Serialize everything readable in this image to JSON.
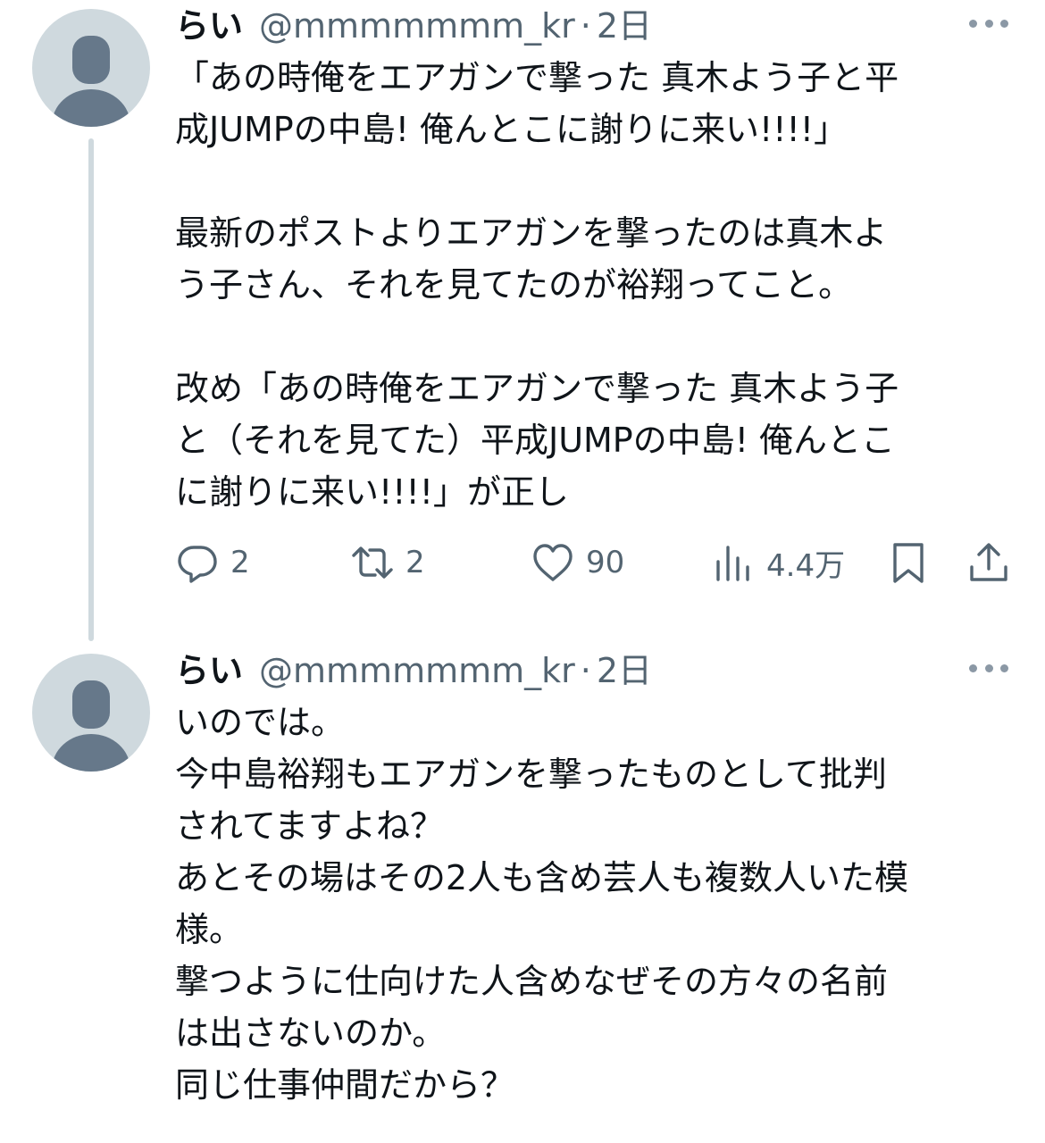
{
  "tweets": [
    {
      "name": "らい",
      "handle": "@mmmmmmm_kr",
      "separator": "·",
      "time": "2日",
      "text": "「あの時俺をエアガンで撃った 真木よう子と平\n成JUMPの中島! 俺んとこに謝りに来い!!!!」\n\n最新のポストよりエアガンを撃ったのは真木よ\nう子さん、それを見てたのが裕翔ってこと。\n\n改め「あの時俺をエアガンで撃った 真木よう子\nと（それを見てた）平成JUMPの中島! 俺んとこ\nに謝りに来い!!!!」が正し",
      "reply_count": "2",
      "retweet_count": "2",
      "like_count": "90",
      "view_count": "4.4万"
    },
    {
      "name": "らい",
      "handle": "@mmmmmmm_kr",
      "separator": "·",
      "time": "2日",
      "text": "いのでは。\n今中島裕翔もエアガンを撃ったものとして批判\nされてますよね？\nあとその場はその2人も含め芸人も複数人いた模\n様。\n撃つように仕向けた人含めなぜその方々の名前\nは出さないのか。\n同じ仕事仲間だから？"
    }
  ],
  "icons": {
    "more": "more-horizontal-icon",
    "reply": "reply-bubble-icon",
    "retweet": "retweet-icon",
    "like": "heart-icon",
    "views": "bar-chart-icon",
    "bookmark": "bookmark-icon",
    "share": "share-upload-icon"
  },
  "colors": {
    "text": "#0f1419",
    "secondary": "#536471",
    "avatar_bg": "#cfd9de",
    "avatar_fg": "#66788a",
    "thread_line": "#cfd9de"
  }
}
